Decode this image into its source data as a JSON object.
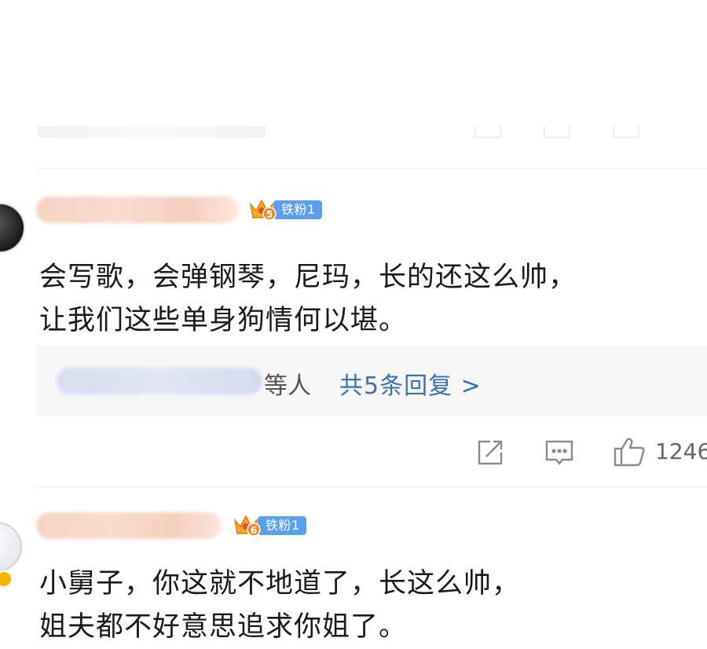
{
  "comments": [
    {
      "level_number": "5",
      "fan_badge_label": "铁粉1",
      "text_lines": [
        "会写歌，会弹钢琴，尼玛，长的还这么帅，",
        "让我们这些单身狗情何以堪。"
      ],
      "replies": {
        "suffix": "等人",
        "link": "共5条回复 >"
      },
      "actions": {
        "like_count": "1246"
      }
    },
    {
      "level_number": "6",
      "fan_badge_label": "铁粉1",
      "text_lines": [
        "小舅子，你这就不地道了，长这么帅，",
        "姐夫都不好意思追求你姐了。"
      ]
    }
  ],
  "icons": [
    "share-icon",
    "comment-icon",
    "like-icon",
    "crown-level-icon"
  ],
  "colors": {
    "fan_badge": "#5aa0ee",
    "reply_link": "#3b6fb6",
    "reply_box": "#f6f6f6"
  }
}
